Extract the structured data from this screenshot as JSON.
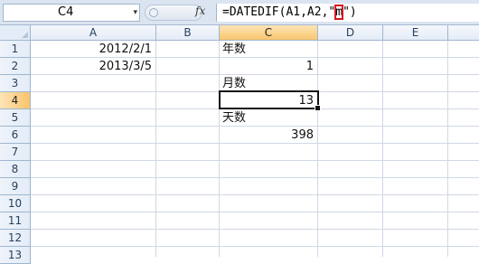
{
  "formula_bar": {
    "name_box": "C4",
    "name_box_arrow": "▾",
    "fx_label": "fx",
    "formula_before": "=DATEDIF(A1,A2,\"",
    "formula_highlight": "m",
    "formula_after": "\")"
  },
  "grid": {
    "columns": [
      "A",
      "B",
      "C",
      "D",
      "E"
    ],
    "active_column": "C",
    "rows": [
      "1",
      "2",
      "3",
      "4",
      "5",
      "6",
      "7",
      "8",
      "9",
      "10",
      "11",
      "12",
      "13"
    ],
    "active_row": "4",
    "cells": {
      "A1": "2012/2/1",
      "A2": "2013/3/5",
      "C1": "年数",
      "C2": "1",
      "C3": "月数",
      "C4": "13",
      "C5": "天数",
      "C6": "398"
    }
  },
  "colors": {
    "selection_border": "#111111",
    "formula_highlight_box": "#d71920",
    "active_header": "#f9c56d"
  }
}
